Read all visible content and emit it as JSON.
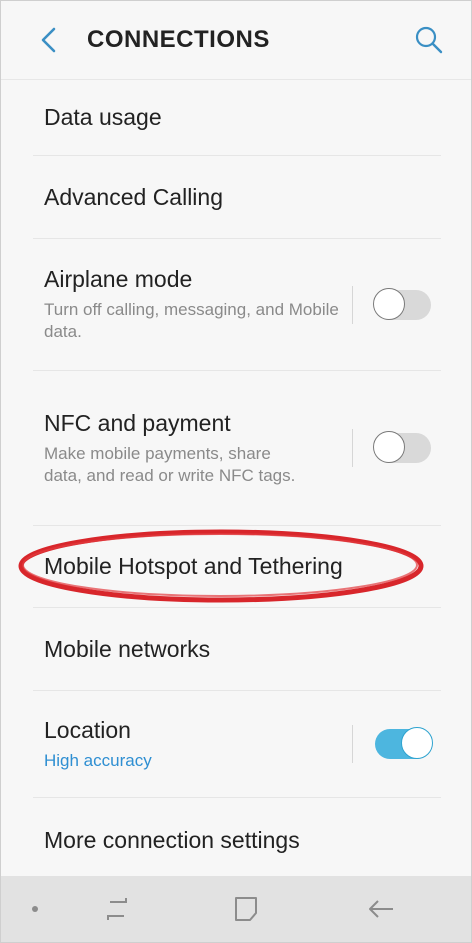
{
  "header": {
    "title": "CONNECTIONS",
    "back_icon": "chevron-left-icon",
    "search_icon": "search-icon",
    "accent_color": "#3a8fc4"
  },
  "items": [
    {
      "label": "Data usage"
    },
    {
      "label": "Advanced Calling"
    },
    {
      "label": "Airplane mode",
      "sub": "Turn off calling, messaging, and Mobile data.",
      "toggle": "off"
    },
    {
      "label": "NFC and payment",
      "sub": "Make mobile payments, share data, and read or write NFC tags.",
      "toggle": "off"
    },
    {
      "label": "Mobile Hotspot and Tethering",
      "highlighted": true
    },
    {
      "label": "Mobile networks"
    },
    {
      "label": "Location",
      "sub": "High accuracy",
      "toggle": "on"
    },
    {
      "label": "More connection settings"
    }
  ],
  "colors": {
    "toggle_on": "#4db6df",
    "toggle_off": "#d9d9d9",
    "highlight_ring": "#d8262b",
    "sub_accent": "#2f8fd2"
  },
  "navbar": {
    "icons": [
      "dot-icon",
      "recent-apps-icon",
      "home-icon",
      "back-arrow-icon"
    ]
  }
}
